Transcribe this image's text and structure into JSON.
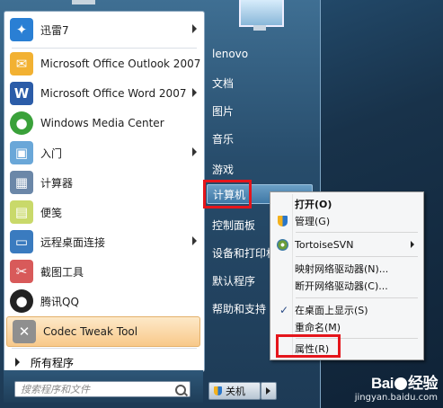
{
  "left_programs": [
    {
      "label": "迅雷7",
      "icon": "thunder-icon",
      "color": "#2a7fd4",
      "glyph": "✦",
      "arrow": true
    },
    {
      "label": "Microsoft Office Outlook 2007",
      "icon": "outlook-icon",
      "color": "#f2b132",
      "glyph": "✉",
      "arrow": false
    },
    {
      "label": "Microsoft Office Word 2007",
      "icon": "word-icon",
      "color": "#2b5ca8",
      "glyph": "W",
      "arrow": true
    },
    {
      "label": "Windows Media Center",
      "icon": "media-center-icon",
      "color": "#3aa13a",
      "glyph": "●",
      "arrow": false
    },
    {
      "label": "入门",
      "icon": "getting-started-icon",
      "color": "#6aa7d8",
      "glyph": "▣",
      "arrow": true
    },
    {
      "label": "计算器",
      "icon": "calculator-icon",
      "color": "#6b87a8",
      "glyph": "▦",
      "arrow": false
    },
    {
      "label": "便笺",
      "icon": "sticky-notes-icon",
      "color": "#c9d96a",
      "glyph": "▤",
      "arrow": false
    },
    {
      "label": "远程桌面连接",
      "icon": "remote-desktop-icon",
      "color": "#3a7bbf",
      "glyph": "▭",
      "arrow": true
    },
    {
      "label": "截图工具",
      "icon": "snipping-tool-icon",
      "color": "#d85a5a",
      "glyph": "✂",
      "arrow": false
    },
    {
      "label": "腾讯QQ",
      "icon": "qq-icon",
      "color": "#222222",
      "glyph": "●",
      "arrow": false
    },
    {
      "label": "Codec Tweak Tool",
      "icon": "codec-tool-icon",
      "color": "#8f8f8f",
      "glyph": "✕",
      "arrow": false
    }
  ],
  "all_programs_label": "所有程序",
  "search": {
    "placeholder": "搜索程序和文件"
  },
  "right_items": [
    "lenovo",
    "文档",
    "图片",
    "音乐",
    "游戏",
    "计算机",
    "控制面板",
    "设备和打印机",
    "默认程序",
    "帮助和支持"
  ],
  "shutdown_label": "关机",
  "context_menu": {
    "open": "打开(O)",
    "manage": "管理(G)",
    "tortoise": "TortoiseSVN",
    "map_drive": "映射网络驱动器(N)...",
    "disconnect_drive": "断开网络驱动器(C)...",
    "show_on_desktop": "在桌面上显示(S)",
    "rename": "重命名(M)",
    "properties": "属性(R)"
  },
  "watermark": {
    "brand_left": "Bai",
    "brand_right": "经验",
    "url": "jingyan.baidu.com"
  }
}
